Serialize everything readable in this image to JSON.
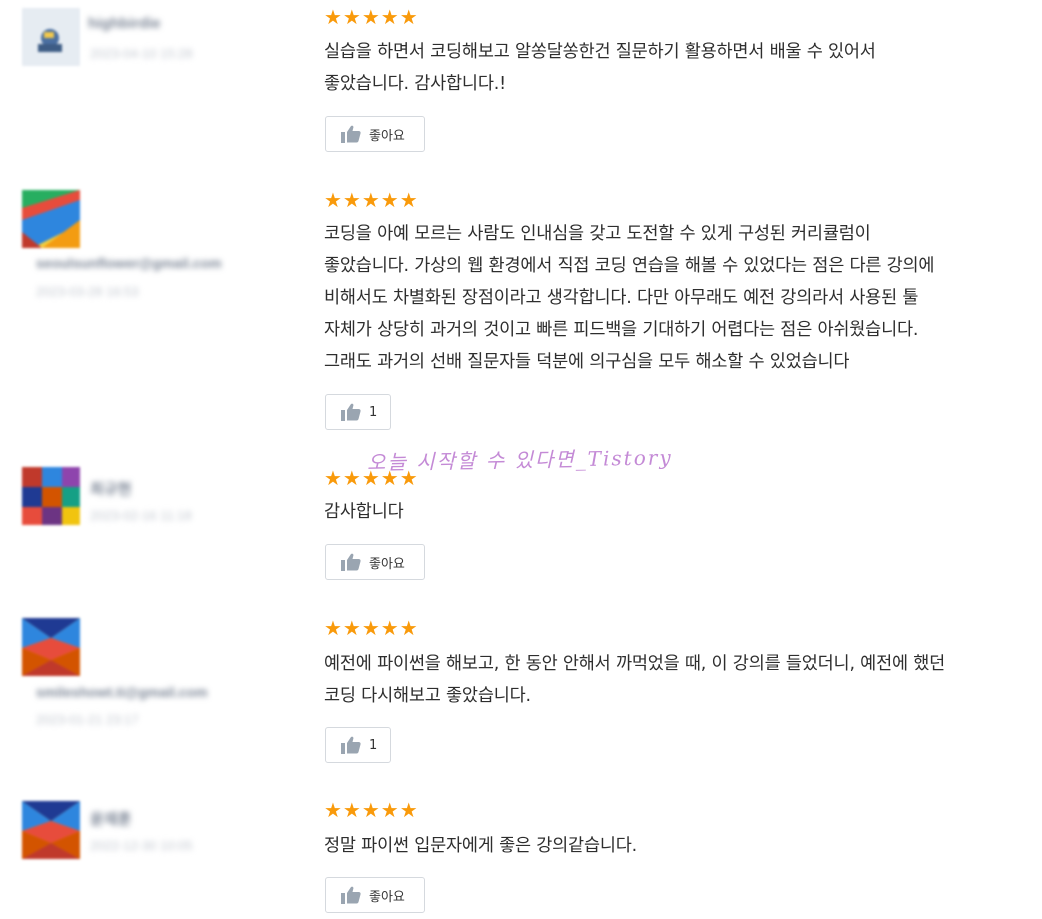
{
  "reviews": [
    {
      "name": "highbirdie",
      "date": "2023-04-10 15:28",
      "stars": "★★★★★",
      "rating": 5,
      "text": "실습을 하면서 코딩해보고 알쏭달쏭한건 질문하기 활용하면서 배울 수 있어서\n좋았습니다. 감사합니다.!",
      "like_label": "좋아요"
    },
    {
      "name": "seoulsunflower@gmail.com",
      "date": "2023-03-28 16:53",
      "stars": "★★★★★",
      "rating": 5,
      "text": "코딩을 아예 모르는 사람도 인내심을 갖고 도전할 수 있게 구성된 커리큘럼이\n좋았습니다. 가상의 웹 환경에서 직접 코딩 연습을 해볼 수 있었다는 점은 다른 강의에\n비해서도 차별화된 장점이라고 생각합니다. 다만 아무래도 예전 강의라서 사용된 툴\n자체가 상당히 과거의 것이고 빠른 피드백을 기대하기 어렵다는 점은 아쉬웠습니다.\n그래도 과거의 선배 질문자들 덕분에 의구심을 모두 해소할 수 있었습니다",
      "like_label": "1"
    },
    {
      "name": "최규현",
      "date": "2023-02-16 11:18",
      "stars": "★★★★★",
      "rating": 5,
      "text": "감사합니다",
      "like_label": "좋아요"
    },
    {
      "name": "smileshowt.ti@gmail.com",
      "date": "2023-01-21 23:17",
      "stars": "★★★★★",
      "rating": 5,
      "text": "예전에 파이썬을 해보고, 한 동안 안해서 까먹었을 때, 이 강의를 들었더니, 예전에 했던\n코딩 다시해보고 좋았습니다.",
      "like_label": "1"
    },
    {
      "name": "윤재훈",
      "date": "2022-12-30 10:05",
      "stars": "★★★★★",
      "rating": 5,
      "text": "정말 파이썬 입문자에게 좋은 강의같습니다.",
      "like_label": "좋아요"
    }
  ],
  "watermark": "오늘 시작할 수 있다면_Tistory",
  "colors": {
    "star": "#f99a0b",
    "border": "#d5d9de",
    "thumb": "#9aa5b1",
    "watermark": "#c48ad6"
  },
  "icons": {
    "like": "thumbs-up-icon",
    "star": "star-icon"
  }
}
